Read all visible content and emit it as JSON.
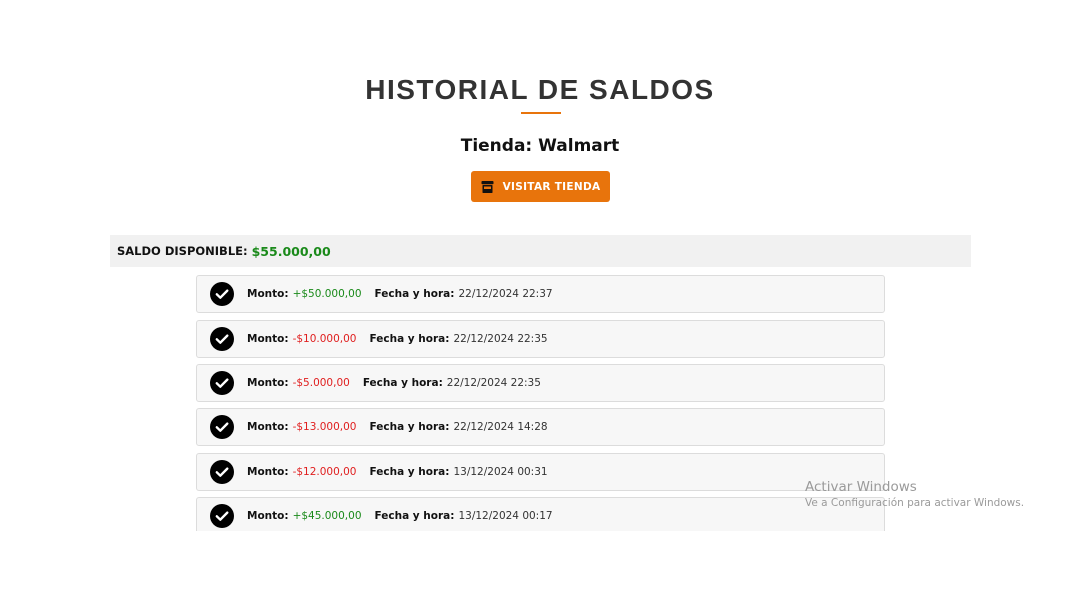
{
  "header": {
    "title": "HISTORIAL DE SALDOS",
    "store_label": "Tienda: Walmart",
    "visit_button": {
      "label": "VISITAR TIENDA",
      "icon": "store-icon"
    }
  },
  "balance": {
    "label": "SALDO DISPONIBLE:",
    "value": "$55.000,00"
  },
  "transactions": [
    {
      "amount_label": "Monto:",
      "amount": "+$50.000,00",
      "date_label": "Fecha y hora:",
      "date": "22/12/2024 22:37",
      "status_icon": "check-circle-icon"
    },
    {
      "amount_label": "Monto:",
      "amount": "-$10.000,00",
      "date_label": "Fecha y hora:",
      "date": "22/12/2024 22:35",
      "status_icon": "check-circle-icon"
    },
    {
      "amount_label": "Monto:",
      "amount": "-$5.000,00",
      "date_label": "Fecha y hora:",
      "date": "22/12/2024 22:35",
      "status_icon": "check-circle-icon"
    },
    {
      "amount_label": "Monto:",
      "amount": "-$13.000,00",
      "date_label": "Fecha y hora:",
      "date": "22/12/2024 14:28",
      "status_icon": "check-circle-icon"
    },
    {
      "amount_label": "Monto:",
      "amount": "-$12.000,00",
      "date_label": "Fecha y hora:",
      "date": "13/12/2024 00:31",
      "status_icon": "check-circle-icon"
    },
    {
      "amount_label": "Monto:",
      "amount": "+$45.000,00",
      "date_label": "Fecha y hora:",
      "date": "13/12/2024 00:17",
      "status_icon": "check-circle-icon"
    }
  ],
  "colors": {
    "accent": "#e8740c",
    "positive": "#1a8a1a",
    "negative": "#e02020"
  },
  "watermark": {
    "line1": "Activar Windows",
    "line2": "Ve a Configuración para activar Windows."
  }
}
